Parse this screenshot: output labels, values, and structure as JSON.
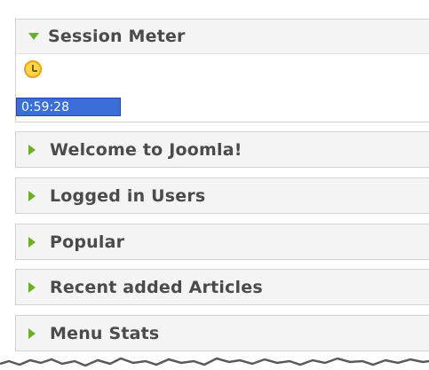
{
  "session_meter": {
    "title": "Session Meter",
    "timer": "0:59:28"
  },
  "panels": [
    {
      "title": "Welcome to Joomla!"
    },
    {
      "title": "Logged in Users"
    },
    {
      "title": "Popular"
    },
    {
      "title": "Recent added Articles"
    },
    {
      "title": "Menu Stats"
    }
  ],
  "colors": {
    "arrow": "#6aae2c",
    "header_bg": "#f4f4f4",
    "timer_bg": "#3a6ed8",
    "title_text": "#4b4b4b"
  },
  "icons": {
    "expanded": "triangle-down-icon",
    "collapsed": "triangle-right-icon",
    "timer": "clock-icon"
  }
}
